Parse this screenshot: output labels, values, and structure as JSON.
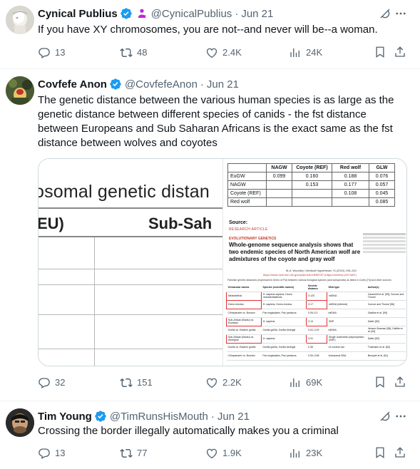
{
  "tweets": [
    {
      "name": "Cynical Publius",
      "handle": "@CynicalPublius",
      "date": "Jun 21",
      "text": "If you have XY chromosomes, you are not--and never will be--a woman.",
      "replies": "13",
      "reposts": "48",
      "likes": "2.4K",
      "views": "24K"
    },
    {
      "name": "Covfefe Anon",
      "handle": "@CovfefeAnon",
      "date": "Jun 21",
      "text": "The genetic distance between the various human species is as large as the genetic distance between different species of canids - the fst distance between Europeans and Sub Saharan Africans is the exact same as the fst distance between wolves and coyotes",
      "replies": "32",
      "reposts": "151",
      "likes": "2.2K",
      "views": "69K"
    },
    {
      "name": "Tim Young",
      "handle": "@TimRunsHisMouth",
      "date": "Jun 21",
      "text": "Crossing the border illegally automatically makes you a criminal",
      "replies": "13",
      "reposts": "77",
      "likes": "1.9K",
      "views": "23K"
    }
  ],
  "media": {
    "left": {
      "title_fragment": "osomal genetic distan",
      "col1": "EU)",
      "col2": "Sub-Sah"
    },
    "table": {
      "headers": [
        "",
        "NAGW",
        "Coyote (REF)",
        "Red wolf",
        "GLW"
      ],
      "rows": [
        [
          "EuGW",
          "0.099",
          "0.160",
          "0.188",
          "0.076"
        ],
        [
          "NAGW",
          "",
          "0.153",
          "0.177",
          "0.057"
        ],
        [
          "Coyote (REF)",
          "",
          "",
          "0.108",
          "0.045"
        ],
        [
          "Red wolf",
          "",
          "",
          "",
          "0.085"
        ]
      ]
    },
    "source_label": "Source:",
    "research_label": "RESEARCH ARTICLE",
    "section_label": "EVOLUTIONARY GENETICS",
    "paper_title": "Whole-genome sequence analysis shows that two endemic species of North American wolf are admixtures of the coyote and gray wolf",
    "journal": "M.A. Woodley / Medical Hypotheses 74 (2010) 195–201",
    "url": "https://www.ncbi.nlm.nih.gov/pubmed/19695787 (https://archive.ph/YIo67)",
    "caption": "Pairwise genetic distances (expressed in terms of Fst) between various biological species (and subspecies) as listed in Curtis [74] and other sources",
    "mini_headers": [
      "Vernacular names",
      "Species (scientific names)",
      "Genetic distance",
      "DNA type",
      "Author(s)"
    ],
    "mini_rows": [
      [
        "Neanderthal",
        "H. sapiens sapiens, Homo neanderthalensis",
        "0.120",
        "mtDNA",
        "Caramelli et al. [55]; Curnoe and Thorne"
      ],
      [
        "Homo erectus",
        "H. sapiens, Homo erectus",
        "0.17",
        "mtDNA (inferred)",
        "Curnoe and Thorne [56]"
      ],
      [
        "Chimpanzee vs. Bonobo",
        "Pan troglodytes, Pan paniscus",
        "0.09–0.2",
        "mtDNA",
        "Gadikis et al. [59]"
      ],
      [
        "Sub-African (Bantu) vs. Eurasian",
        "H. sapiens",
        "0.14",
        "SNP",
        "Salter [53]"
      ],
      [
        "Gorilla vs. Eastern gorilla",
        "Gorilla gorilla, Gorilla beringei",
        "0.02–0.29",
        "mtDNA",
        "Jensen-Seaman [58]; Gaillite et al. [60]"
      ],
      [
        "Sub-African (Bantu) vs. Aborigine",
        "H. sapiens",
        "0.31",
        "Single nucleotide polymorphism (SNP)",
        "Salter [53]"
      ],
      [
        "Gorilla vs. Eastern gorilla",
        "Gorilla gorilla, Gorilla beringei",
        "0.38",
        "14 nuclear loci",
        "Thalmann et al. [60]"
      ],
      [
        "Chimpanzee vs. Bonobo",
        "Pan troglodytes, Pan paniscus",
        "0.30–0.58",
        "Autosomal DNA",
        "Becquet et al. [61]"
      ]
    ]
  },
  "colors": {
    "text": "#0f1419",
    "secondary": "#536471",
    "verified": "#1d9bf0",
    "divider": "#eff3f4",
    "affiliate": "#c026d3"
  }
}
